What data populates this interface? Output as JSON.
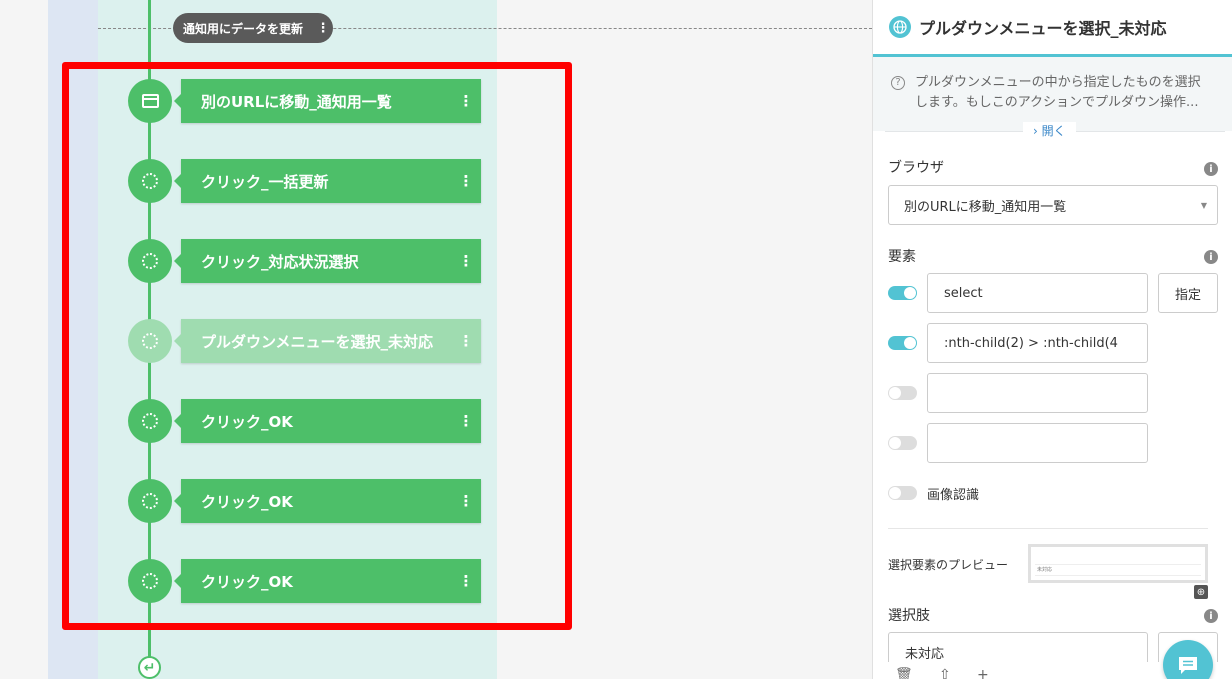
{
  "canvas": {
    "group_label": "通知用にデータを更新",
    "kebab": "⋮",
    "end_icon": "↵",
    "nodes": [
      {
        "title": "別のURLに移動_通知用一覧",
        "icon": "browser-icon",
        "active": false
      },
      {
        "title": "クリック_一括更新",
        "icon": "dotted-circle-icon",
        "active": false
      },
      {
        "title": "クリック_対応状況選択",
        "icon": "dotted-circle-icon",
        "active": false
      },
      {
        "title": "プルダウンメニューを選択_未対応",
        "icon": "dotted-circle-icon",
        "active": true
      },
      {
        "title": "クリック_OK",
        "icon": "dotted-circle-icon",
        "active": false
      },
      {
        "title": "クリック_OK",
        "icon": "dotted-circle-icon",
        "active": false
      },
      {
        "title": "クリック_OK",
        "icon": "dotted-circle-icon",
        "active": false
      }
    ],
    "colors": {
      "node": "#4dbf69",
      "node_active": "#9fdcb0",
      "highlight": "#ff0000"
    }
  },
  "panel": {
    "title": "プルダウンメニューを選択_未対応",
    "description": "プルダウンメニューの中から指定したものを選択します。もしこのアクションでプルダウン操作...",
    "open_label": "開く",
    "browser": {
      "label": "ブラウザ",
      "value": "別のURLに移動_通知用一覧"
    },
    "element": {
      "label": "要素",
      "specify_label": "指定",
      "selectors": [
        {
          "value": "select",
          "enabled": true
        },
        {
          "value": ":nth-child(2) > :nth-child(4",
          "enabled": true
        },
        {
          "value": "",
          "enabled": false
        },
        {
          "value": "",
          "enabled": false
        }
      ],
      "image_recognition_label": "画像認識",
      "image_recognition_enabled": false
    },
    "preview": {
      "label": "選択要素のプレビュー",
      "content": "未対応"
    },
    "choice": {
      "label": "選択肢",
      "value": "未対応"
    },
    "accent": "#52c3d3"
  }
}
